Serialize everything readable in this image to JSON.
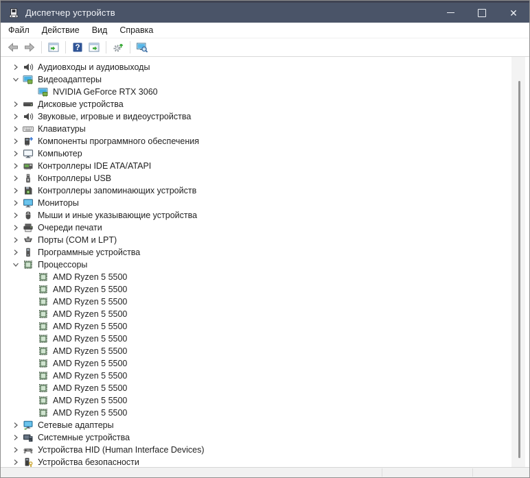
{
  "window": {
    "title": "Диспетчер устройств",
    "controls": [
      "minimize",
      "maximize",
      "close"
    ]
  },
  "menu": {
    "items": [
      "Файл",
      "Действие",
      "Вид",
      "Справка"
    ]
  },
  "toolbar": {
    "groups": [
      [
        "back-arrow",
        "forward-arrow"
      ],
      [
        "show-console-tree"
      ],
      [
        "help",
        "show-action-pane"
      ],
      [
        "scan-hardware-changes"
      ],
      [
        "device-search"
      ]
    ]
  },
  "tree": {
    "items": [
      {
        "label": "Аудиовходы и аудиовыходы",
        "icon": "audio",
        "state": "collapsed",
        "level": 0
      },
      {
        "label": "Видеоадаптеры",
        "icon": "display-adapter",
        "state": "expanded",
        "level": 0
      },
      {
        "label": "NVIDIA GeForce RTX 3060",
        "icon": "display-adapter",
        "state": "leaf",
        "level": 1
      },
      {
        "label": "Дисковые устройства",
        "icon": "disk-drive",
        "state": "collapsed",
        "level": 0
      },
      {
        "label": "Звуковые, игровые и видеоустройства",
        "icon": "audio",
        "state": "collapsed",
        "level": 0
      },
      {
        "label": "Клавиатуры",
        "icon": "keyboard",
        "state": "collapsed",
        "level": 0
      },
      {
        "label": "Компоненты программного обеспечения",
        "icon": "software-component",
        "state": "collapsed",
        "level": 0
      },
      {
        "label": "Компьютер",
        "icon": "computer",
        "state": "collapsed",
        "level": 0
      },
      {
        "label": "Контроллеры IDE ATA/ATAPI",
        "icon": "ide-controller",
        "state": "collapsed",
        "level": 0
      },
      {
        "label": "Контроллеры USB",
        "icon": "usb-controller",
        "state": "collapsed",
        "level": 0
      },
      {
        "label": "Контроллеры запоминающих устройств",
        "icon": "storage-controller",
        "state": "collapsed",
        "level": 0
      },
      {
        "label": "Мониторы",
        "icon": "monitor",
        "state": "collapsed",
        "level": 0
      },
      {
        "label": "Мыши и иные указывающие устройства",
        "icon": "mouse",
        "state": "collapsed",
        "level": 0
      },
      {
        "label": "Очереди печати",
        "icon": "printer",
        "state": "collapsed",
        "level": 0
      },
      {
        "label": "Порты (COM и LPT)",
        "icon": "port",
        "state": "collapsed",
        "level": 0
      },
      {
        "label": "Программные устройства",
        "icon": "software-device",
        "state": "collapsed",
        "level": 0
      },
      {
        "label": "Процессоры",
        "icon": "cpu",
        "state": "expanded",
        "level": 0
      },
      {
        "label": "AMD Ryzen 5 5500",
        "icon": "cpu",
        "state": "leaf",
        "level": 1
      },
      {
        "label": "AMD Ryzen 5 5500",
        "icon": "cpu",
        "state": "leaf",
        "level": 1
      },
      {
        "label": "AMD Ryzen 5 5500",
        "icon": "cpu",
        "state": "leaf",
        "level": 1
      },
      {
        "label": "AMD Ryzen 5 5500",
        "icon": "cpu",
        "state": "leaf",
        "level": 1
      },
      {
        "label": "AMD Ryzen 5 5500",
        "icon": "cpu",
        "state": "leaf",
        "level": 1
      },
      {
        "label": "AMD Ryzen 5 5500",
        "icon": "cpu",
        "state": "leaf",
        "level": 1
      },
      {
        "label": "AMD Ryzen 5 5500",
        "icon": "cpu",
        "state": "leaf",
        "level": 1
      },
      {
        "label": "AMD Ryzen 5 5500",
        "icon": "cpu",
        "state": "leaf",
        "level": 1
      },
      {
        "label": "AMD Ryzen 5 5500",
        "icon": "cpu",
        "state": "leaf",
        "level": 1
      },
      {
        "label": "AMD Ryzen 5 5500",
        "icon": "cpu",
        "state": "leaf",
        "level": 1
      },
      {
        "label": "AMD Ryzen 5 5500",
        "icon": "cpu",
        "state": "leaf",
        "level": 1
      },
      {
        "label": "AMD Ryzen 5 5500",
        "icon": "cpu",
        "state": "leaf",
        "level": 1
      },
      {
        "label": "Сетевые адаптеры",
        "icon": "network-adapter",
        "state": "collapsed",
        "level": 0
      },
      {
        "label": "Системные устройства",
        "icon": "system-device",
        "state": "collapsed",
        "level": 0
      },
      {
        "label": "Устройства HID (Human Interface Devices)",
        "icon": "hid-device",
        "state": "collapsed",
        "level": 0
      },
      {
        "label": "Устройства безопасности",
        "icon": "security-device",
        "state": "collapsed",
        "level": 0
      }
    ]
  },
  "colors": {
    "titlebar": "#4a5468",
    "accent_blue": "#49b0e3",
    "chip_green": "#cfe3cf",
    "status_bg": "#f1f1f1"
  }
}
